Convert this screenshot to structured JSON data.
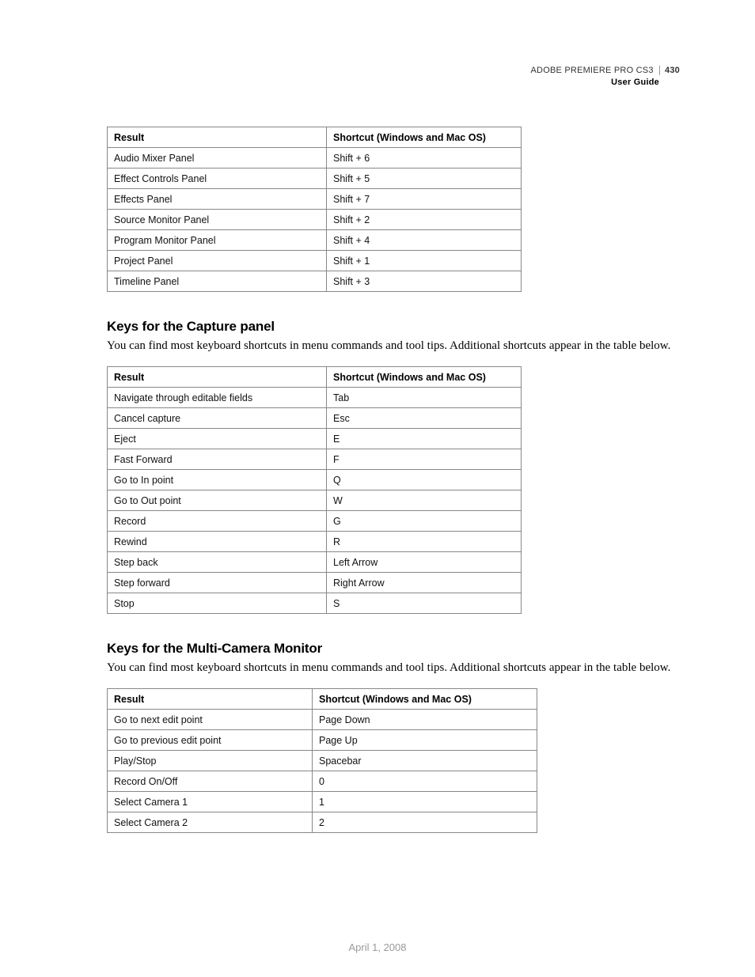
{
  "header": {
    "product": "ADOBE PREMIERE PRO CS3",
    "page_number": "430",
    "subtitle": "User Guide"
  },
  "table1": {
    "headers": {
      "result": "Result",
      "shortcut": "Shortcut (Windows and Mac OS)"
    },
    "rows": [
      {
        "result": "Audio Mixer Panel",
        "shortcut": "Shift + 6"
      },
      {
        "result": "Effect Controls Panel",
        "shortcut": "Shift + 5"
      },
      {
        "result": "Effects Panel",
        "shortcut": "Shift + 7"
      },
      {
        "result": "Source Monitor Panel",
        "shortcut": "Shift + 2"
      },
      {
        "result": "Program Monitor Panel",
        "shortcut": "Shift + 4"
      },
      {
        "result": "Project Panel",
        "shortcut": "Shift + 1"
      },
      {
        "result": "Timeline Panel",
        "shortcut": "Shift + 3"
      }
    ]
  },
  "section2": {
    "heading": "Keys for the Capture panel",
    "intro": "You can find most keyboard shortcuts in menu commands and tool tips. Additional shortcuts appear in the table below."
  },
  "table2": {
    "headers": {
      "result": "Result",
      "shortcut": "Shortcut (Windows and Mac OS)"
    },
    "rows": [
      {
        "result": "Navigate through editable fields",
        "shortcut": "Tab"
      },
      {
        "result": "Cancel capture",
        "shortcut": "Esc"
      },
      {
        "result": "Eject",
        "shortcut": "E"
      },
      {
        "result": "Fast Forward",
        "shortcut": "F"
      },
      {
        "result": "Go to In point",
        "shortcut": "Q"
      },
      {
        "result": "Go to Out point",
        "shortcut": "W"
      },
      {
        "result": "Record",
        "shortcut": "G"
      },
      {
        "result": "Rewind",
        "shortcut": "R"
      },
      {
        "result": "Step back",
        "shortcut": "Left Arrow"
      },
      {
        "result": "Step forward",
        "shortcut": "Right Arrow"
      },
      {
        "result": "Stop",
        "shortcut": "S"
      }
    ]
  },
  "section3": {
    "heading": "Keys for the Multi-Camera Monitor",
    "intro": "You can find most keyboard shortcuts in menu commands and tool tips. Additional shortcuts appear in the table below."
  },
  "table3": {
    "headers": {
      "result": "Result",
      "shortcut": "Shortcut (Windows and Mac OS)"
    },
    "rows": [
      {
        "result": "Go to next edit point",
        "shortcut": "Page Down"
      },
      {
        "result": "Go to previous edit point",
        "shortcut": "Page Up"
      },
      {
        "result": "Play/Stop",
        "shortcut": "Spacebar"
      },
      {
        "result": "Record On/Off",
        "shortcut": "0"
      },
      {
        "result": "Select Camera 1",
        "shortcut": "1"
      },
      {
        "result": "Select Camera 2",
        "shortcut": "2"
      }
    ]
  },
  "footer": {
    "date": "April 1, 2008"
  }
}
